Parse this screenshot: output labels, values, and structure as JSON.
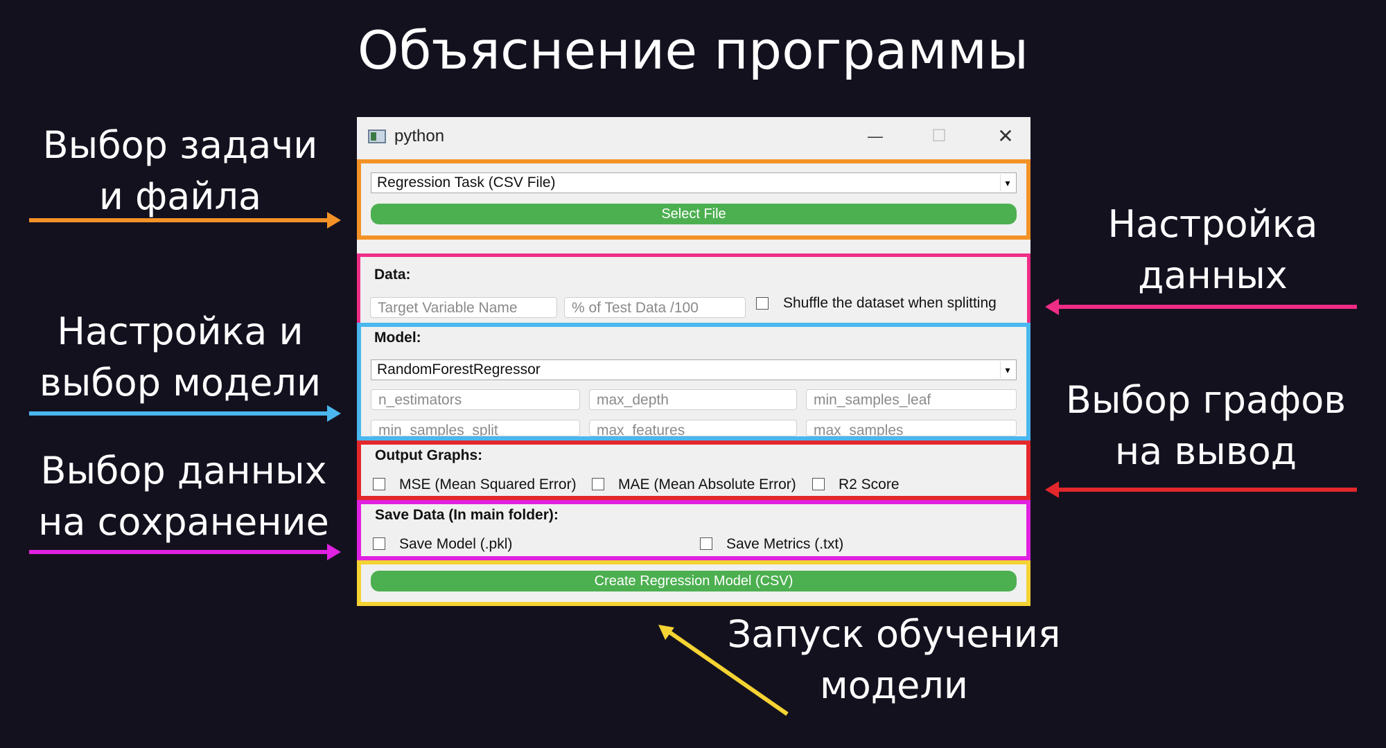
{
  "slide_title": "Объяснение программы",
  "annotations": {
    "task_file": [
      "Выбор задачи",
      "и файла"
    ],
    "model": [
      "Настройка и",
      "выбор модели"
    ],
    "save": [
      "Выбор данных",
      "на сохранение"
    ],
    "data": [
      "Настройка",
      "данных"
    ],
    "graphs": [
      "Выбор графов",
      "на вывод"
    ],
    "run": [
      "Запуск обучения",
      "модели"
    ]
  },
  "colors": {
    "task": "#f39226",
    "data": "#ee2d86",
    "model": "#4ab7ee",
    "output": "#e4272b",
    "save": "#e021e0",
    "run": "#f5d333",
    "button_green": "#4caf50",
    "background": "#14111f"
  },
  "window": {
    "title": "python",
    "icon": "python-window-icon",
    "controls": {
      "minimize": "—",
      "maximize": "☐",
      "close": "✕"
    }
  },
  "task": {
    "selected": "Regression Task (CSV File)",
    "select_file_label": "Select File"
  },
  "data_section": {
    "header": "Data:",
    "target_placeholder": "Target Variable Name",
    "test_placeholder": "% of Test Data /100",
    "shuffle_label": "Shuffle the dataset when splitting"
  },
  "model_section": {
    "header": "Model:",
    "selected": "RandomForestRegressor",
    "params": [
      "n_estimators",
      "max_depth",
      "min_samples_leaf",
      "min_samples_split",
      "max_features",
      "max_samples"
    ]
  },
  "output_section": {
    "header": "Output Graphs:",
    "options": [
      "MSE (Mean Squared Error)",
      "MAE (Mean Absolute Error)",
      "R2 Score"
    ]
  },
  "save_section": {
    "header": "Save Data (In main folder):",
    "save_model": "Save Model (.pkl)",
    "save_metrics": "Save Metrics (.txt)"
  },
  "run": {
    "create_label": "Create Regression Model (CSV)"
  }
}
